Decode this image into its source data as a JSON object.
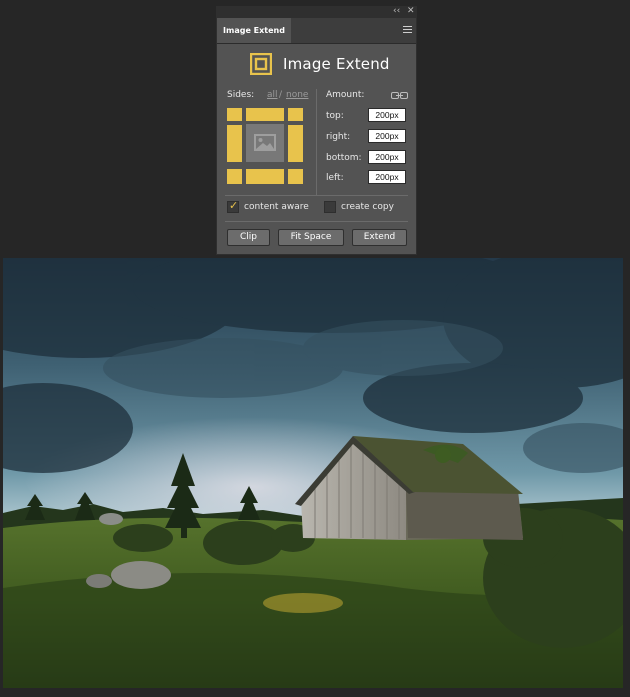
{
  "panel": {
    "window_controls": {
      "collapse": "‹‹",
      "close": "✕"
    },
    "tab_label": "Image Extend",
    "title": "Image Extend",
    "brand_color": "#e8c34c",
    "sides": {
      "label": "Sides:",
      "all": "all",
      "separator": "/",
      "none": "none"
    },
    "amount": {
      "label": "Amount:",
      "fields": [
        {
          "label": "top:",
          "value": "200px"
        },
        {
          "label": "right:",
          "value": "200px"
        },
        {
          "label": "bottom:",
          "value": "200px"
        },
        {
          "label": "left:",
          "value": "200px"
        }
      ]
    },
    "options": {
      "content_aware": {
        "label": "content aware",
        "checked": true
      },
      "create_copy": {
        "label": "create copy",
        "checked": false
      }
    },
    "buttons": {
      "clip": "Clip",
      "fit_space": "Fit Space",
      "extend": "Extend"
    }
  },
  "canvas": {
    "image_subject": "landscape-photo-cabin"
  }
}
